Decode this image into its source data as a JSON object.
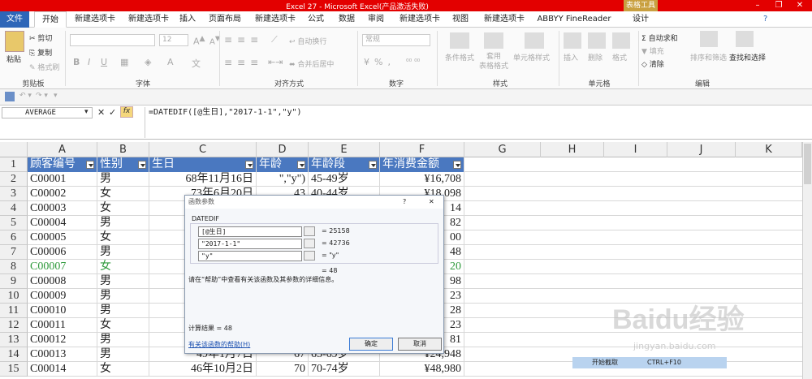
{
  "window": {
    "title": "Excel 27 - Microsoft Excel(产品激活失败)",
    "context_tool": "表格工具",
    "title_bg": "#e30000"
  },
  "tabs": [
    {
      "label": "文件",
      "kind": "file"
    },
    {
      "label": "开始",
      "kind": "active"
    },
    {
      "label": "新建选项卡"
    },
    {
      "label": "新建选项卡"
    },
    {
      "label": "插入"
    },
    {
      "label": "页面布局"
    },
    {
      "label": "新建选项卡"
    },
    {
      "label": "公式"
    },
    {
      "label": "数据"
    },
    {
      "label": "审阅"
    },
    {
      "label": "新建选项卡"
    },
    {
      "label": "视图"
    },
    {
      "label": "新建选项卡"
    },
    {
      "label": "ABBYY FineReader 11"
    },
    {
      "label": "设计"
    }
  ],
  "ribbon": {
    "clipboard": {
      "paste": "粘贴",
      "cut": "剪切",
      "copy": "复制",
      "format_painter": "格式刷",
      "group": "剪贴板"
    },
    "font": {
      "size": "12",
      "group": "字体"
    },
    "alignment": {
      "wrap": "自动换行",
      "merge": "合并后居中",
      "group": "对齐方式"
    },
    "number": {
      "format": "常规",
      "group": "数字"
    },
    "styles": {
      "conditional": "条件格式",
      "table": "套用\n表格格式",
      "cell_styles": "单元格样式",
      "group": "样式"
    },
    "cells": {
      "insert": "插入",
      "delete": "删除",
      "format": "格式",
      "group": "单元格"
    },
    "editing": {
      "autosum": "自动求和",
      "fill": "填充",
      "clear": "清除",
      "sort": "排序和筛选",
      "find": "查找和选择",
      "group": "编辑"
    }
  },
  "formula_bar": {
    "name_box": "AVERAGE",
    "formula": "=DATEDIF([@生日],\"2017-1-1\",\"y\")"
  },
  "columns": [
    "A",
    "B",
    "C",
    "D",
    "E",
    "F",
    "G",
    "H",
    "I",
    "J",
    "K"
  ],
  "header_row": {
    "num": "1",
    "cells": [
      "顾客编号",
      "性别",
      "生日",
      "年龄",
      "年龄段",
      "年消费金额"
    ]
  },
  "rows": [
    {
      "num": "2",
      "a": "C00001",
      "b": "男",
      "c": "68年11月16日",
      "d": "\",\"y\")",
      "e": "45-49岁",
      "f": "¥16,708"
    },
    {
      "num": "3",
      "a": "C00002",
      "b": "女",
      "c": "73年6月20日",
      "d": "43",
      "e": "40-44岁",
      "f": "¥18,098"
    },
    {
      "num": "4",
      "a": "C00003",
      "b": "女",
      "c": "",
      "d": "",
      "e": "",
      "f": "14"
    },
    {
      "num": "5",
      "a": "C00004",
      "b": "男",
      "c": "",
      "d": "",
      "e": "",
      "f": "82"
    },
    {
      "num": "6",
      "a": "C00005",
      "b": "女",
      "c": "6",
      "d": "",
      "e": "",
      "f": "00"
    },
    {
      "num": "7",
      "a": "C00006",
      "b": "男",
      "c": "",
      "d": "",
      "e": "",
      "f": "48"
    },
    {
      "num": "8",
      "a": "C00007",
      "b": "女",
      "c": "",
      "d": "",
      "e": "",
      "f": "20",
      "green": true
    },
    {
      "num": "9",
      "a": "C00008",
      "b": "男",
      "c": "8",
      "d": "",
      "e": "",
      "f": "98"
    },
    {
      "num": "10",
      "a": "C00009",
      "b": "男",
      "c": "6",
      "d": "",
      "e": "",
      "f": "23"
    },
    {
      "num": "11",
      "a": "C00010",
      "b": "男",
      "c": "",
      "d": "",
      "e": "",
      "f": "28"
    },
    {
      "num": "12",
      "a": "C00011",
      "b": "女",
      "c": "",
      "d": "",
      "e": "",
      "f": "23"
    },
    {
      "num": "13",
      "a": "C00012",
      "b": "男",
      "c": "4",
      "d": "",
      "e": "",
      "f": "81"
    },
    {
      "num": "14",
      "a": "C00013",
      "b": "男",
      "c": "49年1月7日",
      "d": "67",
      "e": "65-69岁",
      "f": "¥24,948"
    },
    {
      "num": "15",
      "a": "C00014",
      "b": "女",
      "c": "46年10月2日",
      "d": "70",
      "e": "70-74岁",
      "f": "¥48,980"
    }
  ],
  "dialog": {
    "title": "函数参数",
    "help_glyph": "?",
    "close_glyph": "✕",
    "func_name": "DATEDIF",
    "args": [
      {
        "value": "[@生日]",
        "result": "= 25158"
      },
      {
        "value": "\"2017-1-1\"",
        "result": "= 42736"
      },
      {
        "value": "\"y\"",
        "result": "= \"y\""
      }
    ],
    "overall_result": "= 48",
    "help_text": "请在“帮助”中查看有关该函数及其参数的详细信息。",
    "calc_result": "计算结果 = 48",
    "help_link": "有关该函数的帮助(H)",
    "ok": "确定",
    "cancel": "取消"
  },
  "overlay": {
    "label": "开始截取",
    "shortcut": "CTRL+F10"
  },
  "watermark": {
    "text": "Baidu经验",
    "url": "jingyan.baidu.com"
  }
}
